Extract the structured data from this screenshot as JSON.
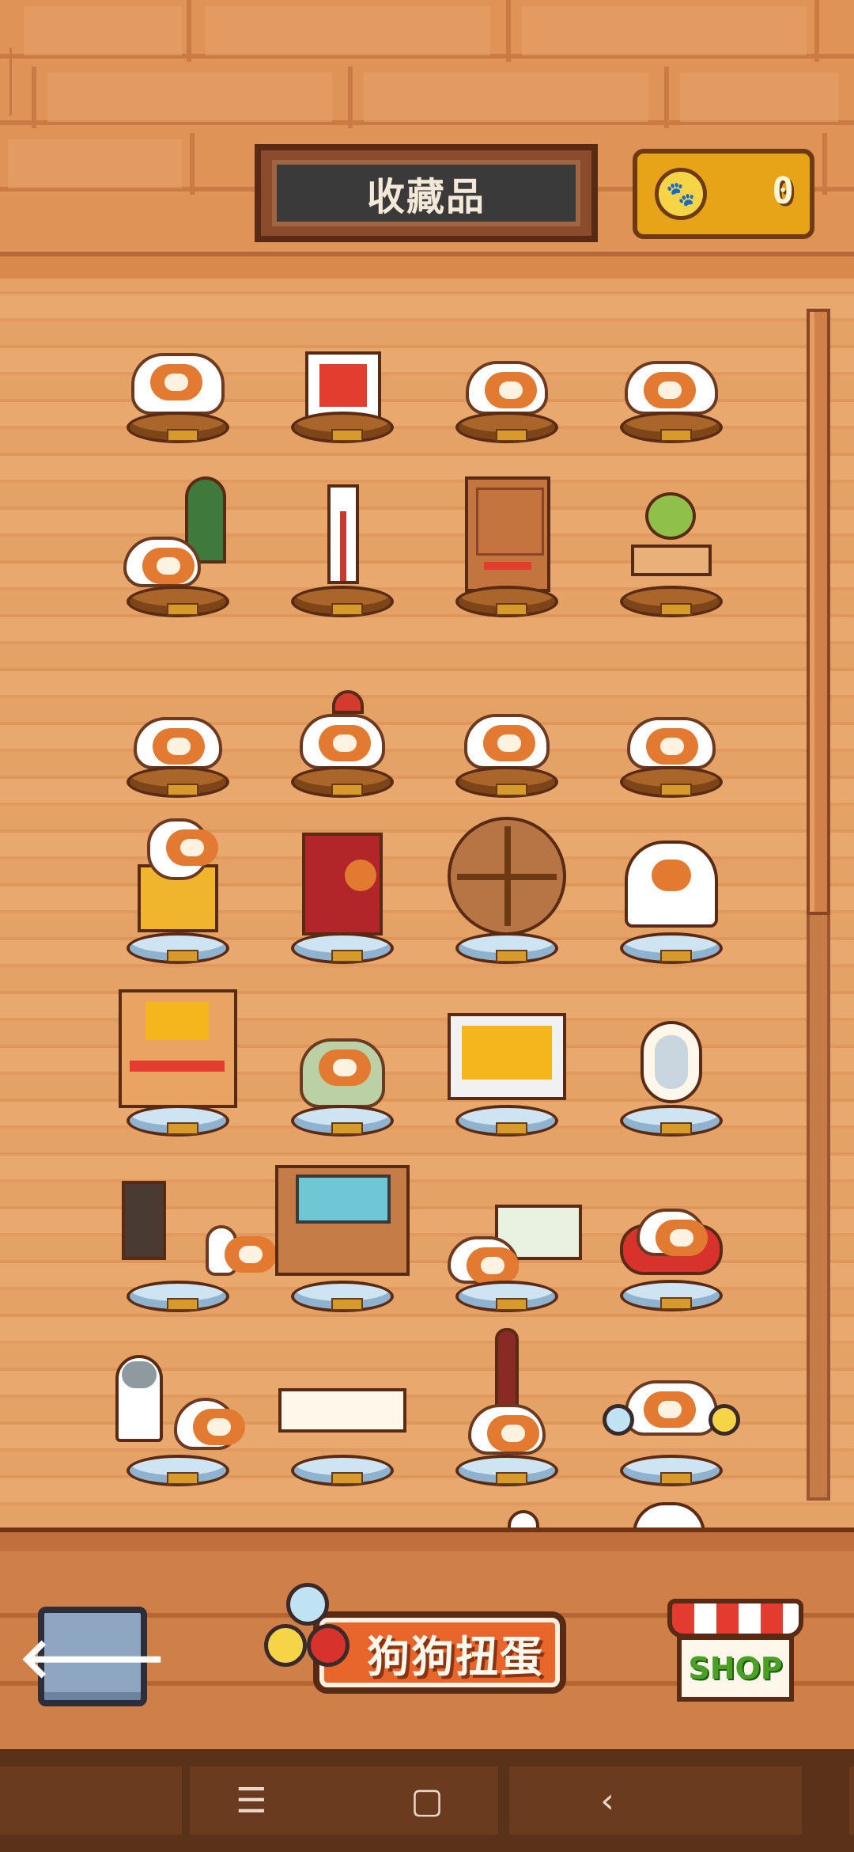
{
  "header": {
    "title": "收藏品",
    "coin_amount": "0"
  },
  "collection": {
    "rows": 7,
    "columns": 4,
    "scroll_fraction_visible": 0.5
  },
  "bottom": {
    "back_label": "🡐",
    "gacha_label": "狗狗扭蛋",
    "shop_label": "SHOP"
  },
  "navbar": {
    "menu_icon": "☰",
    "home_icon": "▢",
    "back_icon": "‹"
  },
  "colors": {
    "accent": "#e8662c",
    "coin": "#e8a418",
    "shop_green": "#49a024"
  }
}
